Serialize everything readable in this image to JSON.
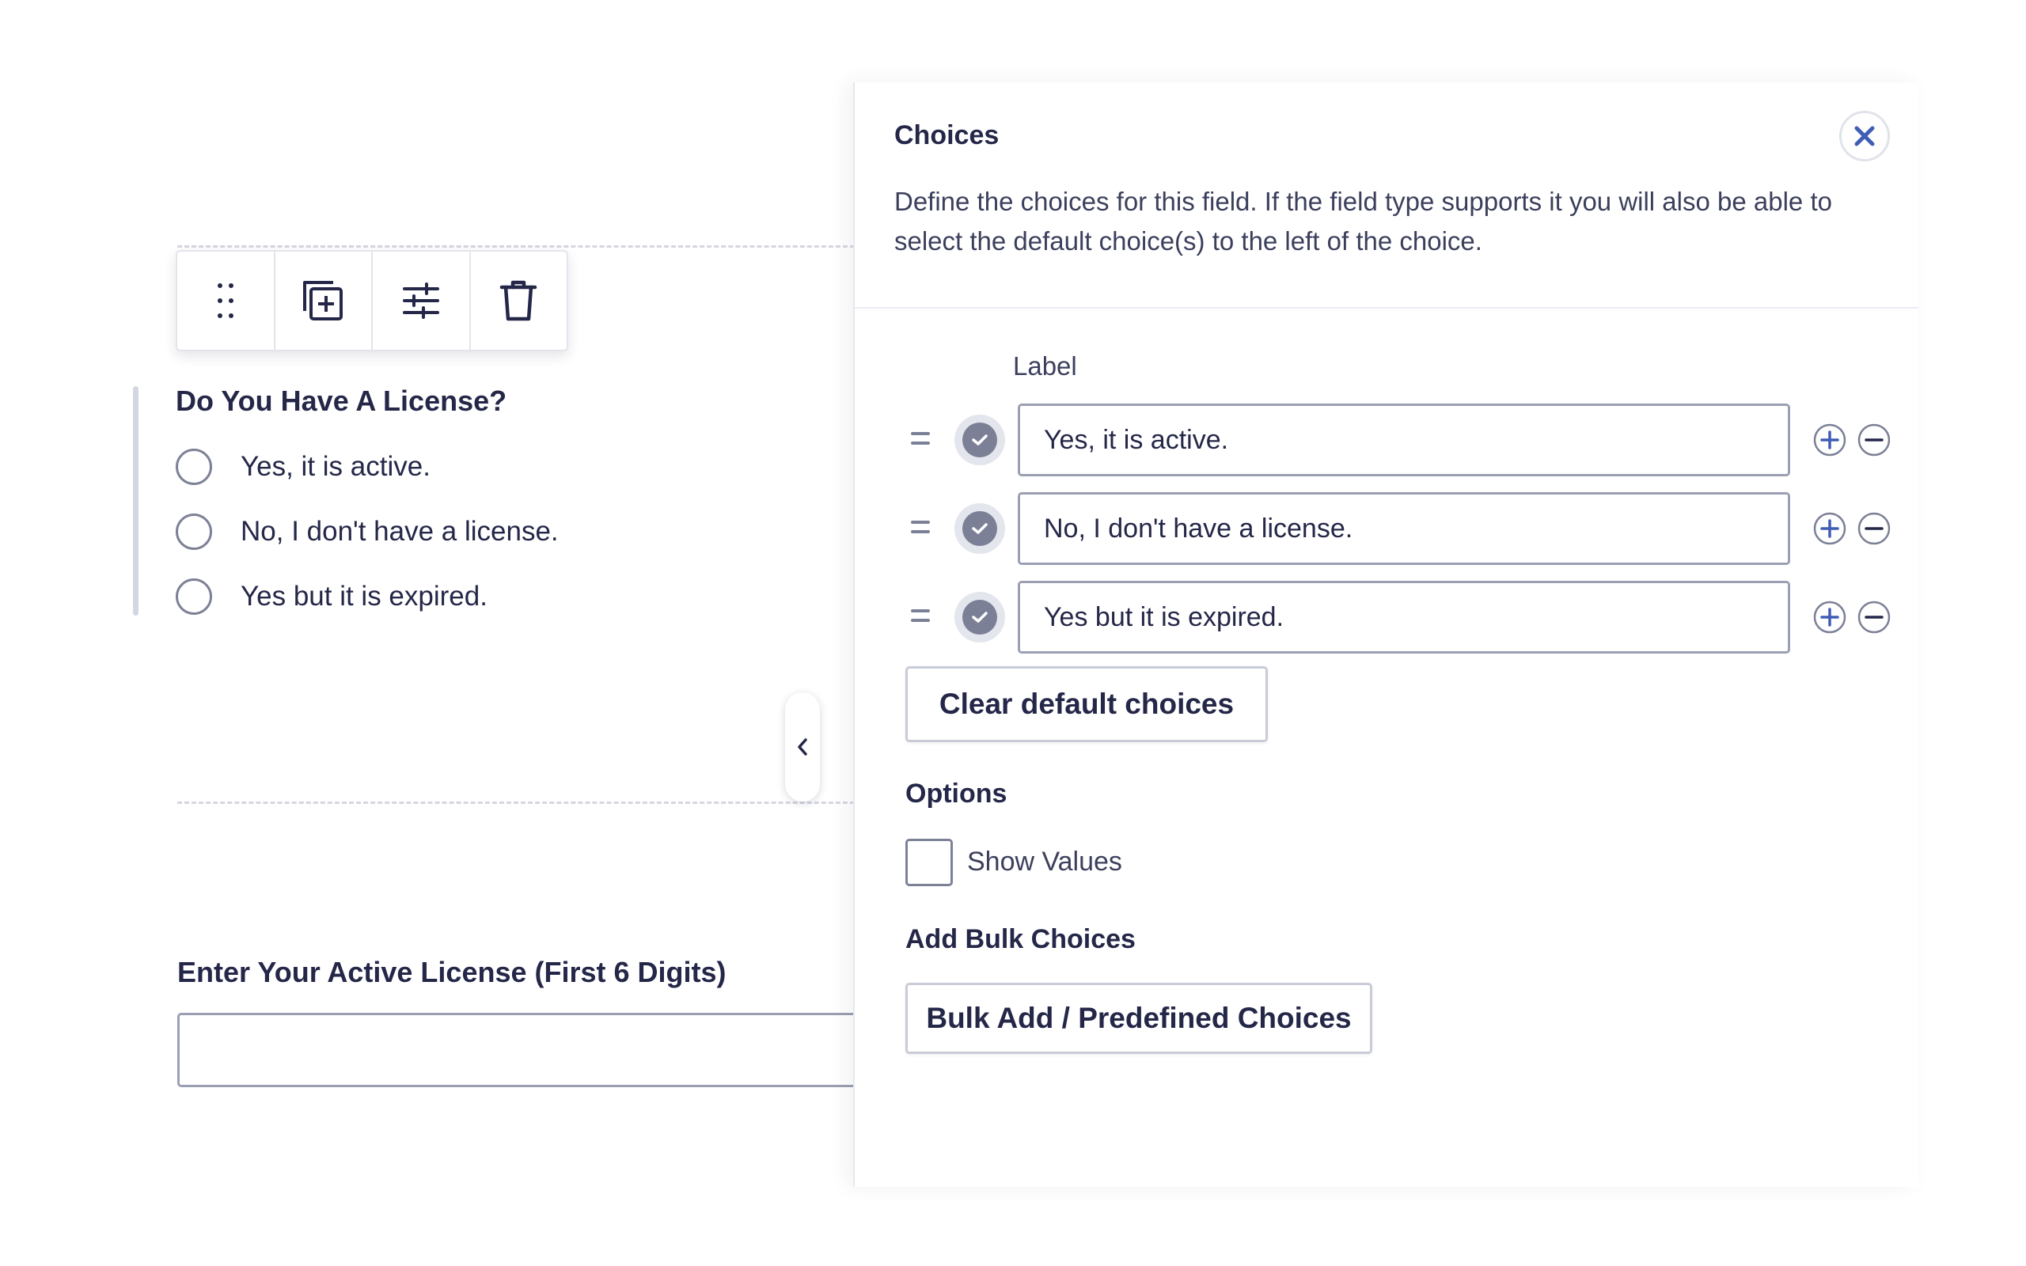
{
  "toolbar": {
    "icons": [
      "drag-handle-icon",
      "duplicate-icon",
      "settings-sliders-icon",
      "trash-icon"
    ]
  },
  "field": {
    "label": "Do You Have A License?",
    "choices": [
      "Yes, it is active.",
      "No, I don't have a license.",
      "Yes but it is expired."
    ]
  },
  "license_field": {
    "label": "Enter Your Active License (First 6 Digits)",
    "value": ""
  },
  "panel": {
    "title": "Choices",
    "description": "Define the choices for this field. If the field type supports it you will also be able to select the default choice(s) to the left of the choice.",
    "column_label": "Label",
    "choices": [
      {
        "label": "Yes, it is active.",
        "default": true
      },
      {
        "label": "No, I don't have a license.",
        "default": true
      },
      {
        "label": "Yes but it is expired.",
        "default": true
      }
    ],
    "clear_button": "Clear default choices",
    "options_label": "Options",
    "show_values_label": "Show Values",
    "show_values_checked": false,
    "bulk_label": "Add Bulk Choices",
    "bulk_button": "Bulk Add / Predefined Choices"
  },
  "colors": {
    "text": "#242748",
    "accent": "#3e5db4",
    "border": "#9b9fb3",
    "check": "#7c8096"
  }
}
